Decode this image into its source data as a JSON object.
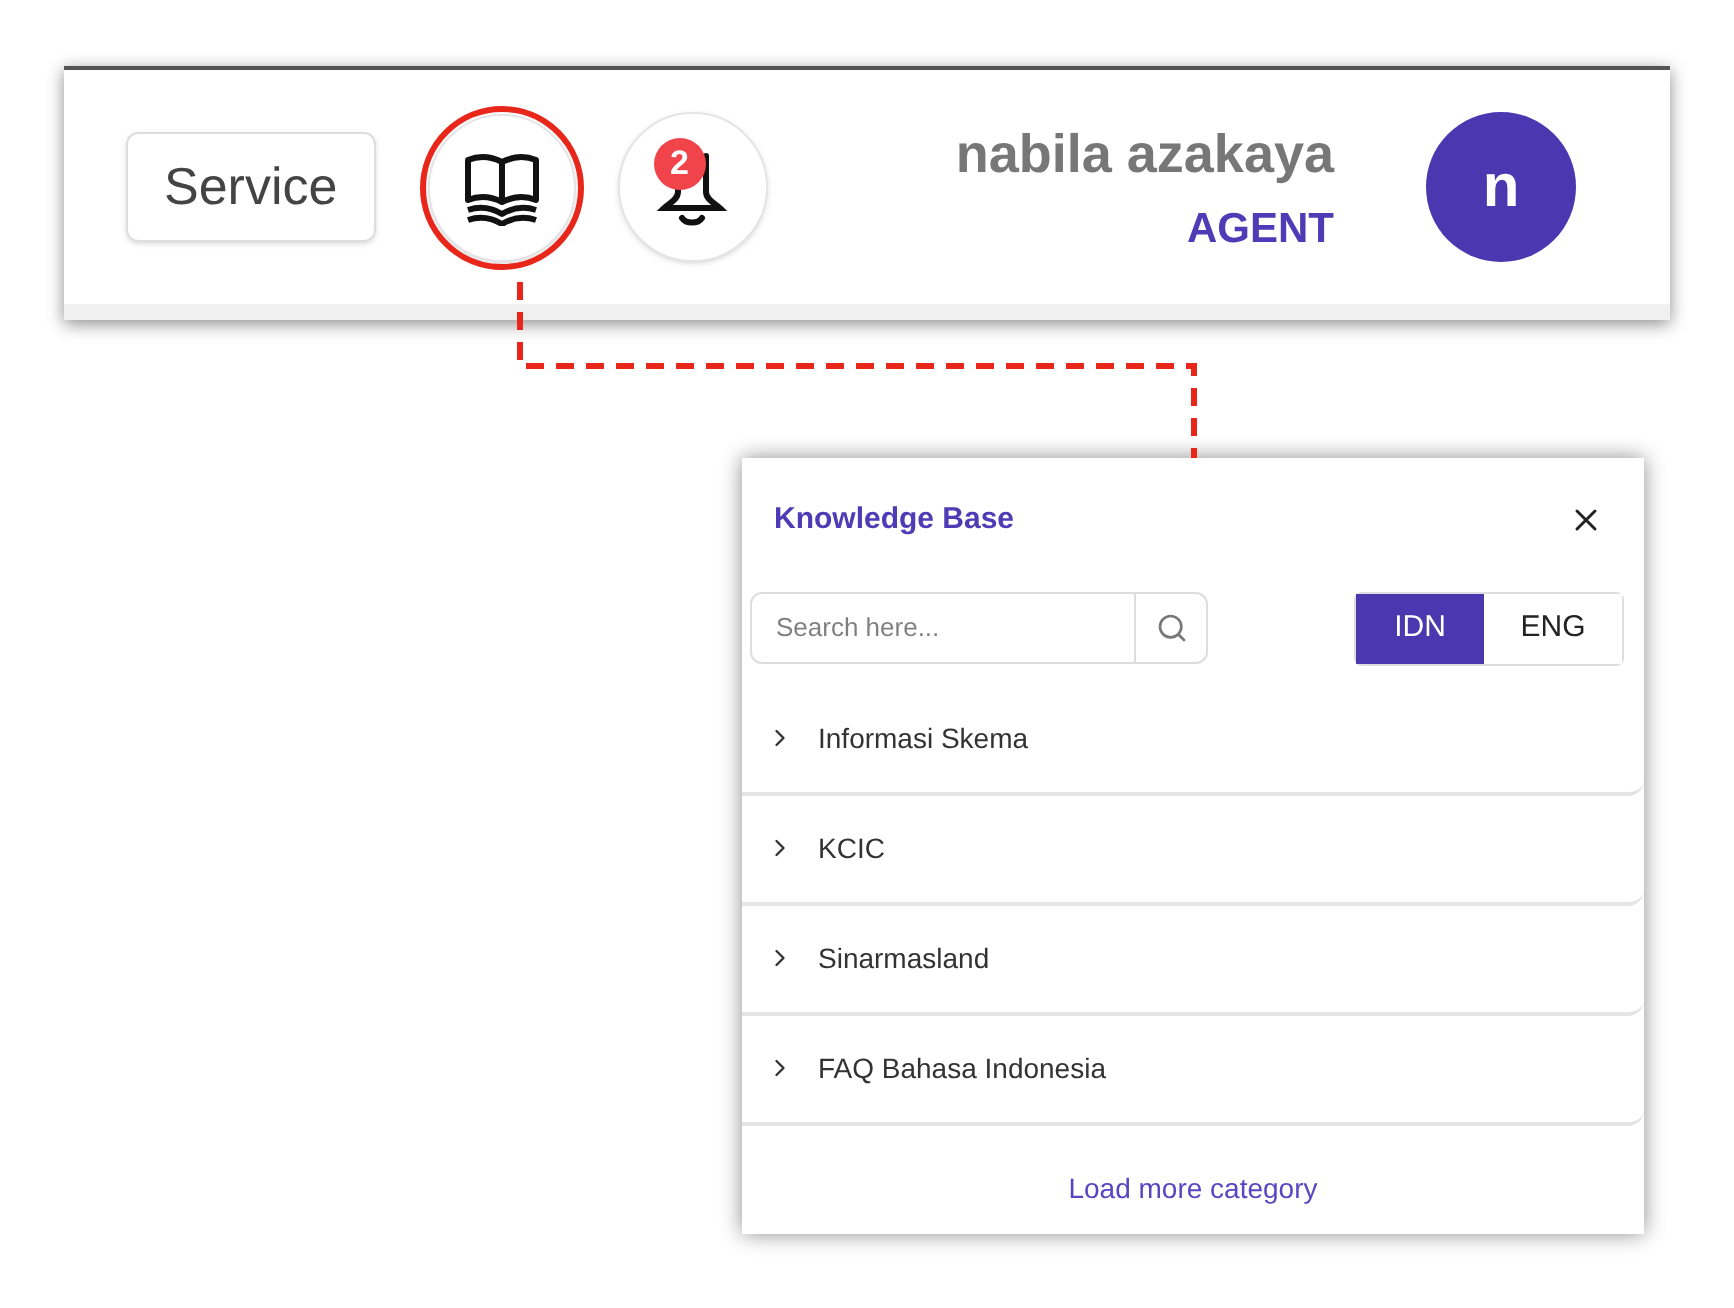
{
  "header": {
    "service_button": "Service",
    "knowledge_button": {
      "annotated": true
    },
    "notifications": {
      "count": "2"
    },
    "user": {
      "name": "nabila azakaya",
      "role": "AGENT",
      "avatar_letter": "n"
    }
  },
  "knowledge_panel": {
    "title": "Knowledge Base",
    "search": {
      "placeholder": "Search here..."
    },
    "languages": [
      {
        "label": "IDN",
        "selected": true
      },
      {
        "label": "ENG",
        "selected": false
      }
    ],
    "categories": [
      {
        "label": "Informasi Skema",
        "expanded": false
      },
      {
        "label": "KCIC",
        "expanded": false
      },
      {
        "label": "Sinarmasland",
        "expanded": false
      },
      {
        "label": "FAQ Bahasa Indonesia",
        "expanded": false
      }
    ],
    "load_more": "Load more category"
  }
}
